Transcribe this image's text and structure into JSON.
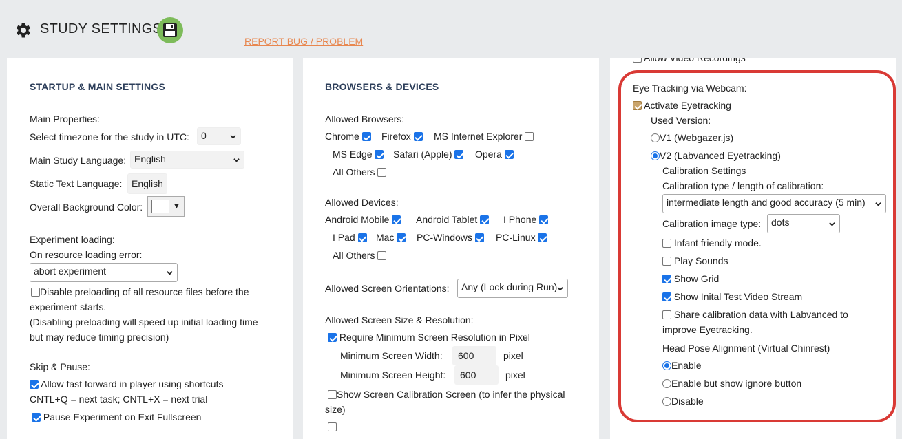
{
  "header": {
    "title": "STUDY SETTINGS",
    "report_link": "REPORT BUG / PROBLEM"
  },
  "startup": {
    "section_title": "STARTUP & MAIN SETTINGS",
    "main_properties_label": "Main Properties:",
    "timezone_label": "Select timezone for the study in UTC:",
    "timezone_value": "0",
    "language_label": "Main Study Language:",
    "language_value": "English",
    "static_text_label": "Static Text Language:",
    "static_text_value": "English",
    "bg_color_label": "Overall Background Color:",
    "exp_loading_label": "Experiment loading:",
    "on_error_label": "On resource loading error:",
    "on_error_value": "abort experiment",
    "disable_preload_line1": "Disable preloading of all resource files before the",
    "disable_preload_line2": "experiment starts.",
    "preload_note_line1": "(Disabling preloading will speed up initial loading time",
    "preload_note_line2": "but may reduce timing precision)",
    "skip_pause_label": "Skip & Pause:",
    "fast_forward_label": "Allow fast forward in player using shortcuts",
    "shortcuts_note": "CNTL+Q = next task; CNTL+X = next trial",
    "pause_exit_label": "Pause Experiment on Exit Fullscreen"
  },
  "browsers": {
    "section_title": "BROWSERS & DEVICES",
    "allowed_browsers_label": "Allowed Browsers:",
    "chrome": "Chrome",
    "firefox": "Firefox",
    "ie": "MS Internet Explorer",
    "edge": "MS Edge",
    "safari": "Safari (Apple)",
    "opera": "Opera",
    "all_others": "All Others",
    "allowed_devices_label": "Allowed Devices:",
    "android_mobile": "Android Mobile",
    "android_tablet": "Android Tablet",
    "iphone": "I Phone",
    "ipad": "I Pad",
    "mac": "Mac",
    "pc_windows": "PC-Windows",
    "pc_linux": "PC-Linux",
    "devices_all_others": "All Others",
    "orientations_label": "Allowed Screen Orientations:",
    "orientations_value": "Any (Lock during Run)",
    "screen_size_label": "Allowed Screen Size & Resolution:",
    "require_min_label": "Require Minimum Screen Resolution in Pixel",
    "min_width_label": "Minimum Screen Width:",
    "min_width_value": "600",
    "min_height_label": "Minimum Screen Height:",
    "min_height_value": "600",
    "pixel_unit": "pixel",
    "calibration_screen_line1": "Show Screen Calibration Screen (to infer the physical",
    "calibration_screen_line2": "size)"
  },
  "eyetracking": {
    "allow_video_label": "Allow Video Recordings",
    "title": "Eye Tracking via Webcam:",
    "activate_label": "Activate Eyetracking",
    "used_version_label": "Used Version:",
    "v1_label": "V1 (Webgazer.js)",
    "v2_label": "V2 (Labvanced Eyetracking)",
    "calibration_settings_label": "Calibration Settings",
    "calibration_type_label": "Calibration type / length of calibration:",
    "calibration_type_value": "intermediate length and good accuracy (5 min)",
    "calibration_image_label": "Calibration image type:",
    "calibration_image_value": "dots",
    "infant_label": "Infant friendly mode.",
    "play_sounds_label": "Play Sounds",
    "show_grid_label": "Show Grid",
    "show_initial_label": "Show Inital Test Video Stream",
    "share_line1": "Share calibration data with Labvanced to",
    "share_line2": "improve Eyetracking.",
    "head_pose_label": "Head Pose Alignment (Virtual Chinrest)",
    "enable_label": "Enable",
    "enable_ignore_label": "Enable but show ignore button",
    "disable_label": "Disable"
  },
  "colors": {
    "accent": "#1a73e8",
    "highlight": "#d93a35",
    "link": "#e8874f",
    "save": "#7dbb5a"
  }
}
